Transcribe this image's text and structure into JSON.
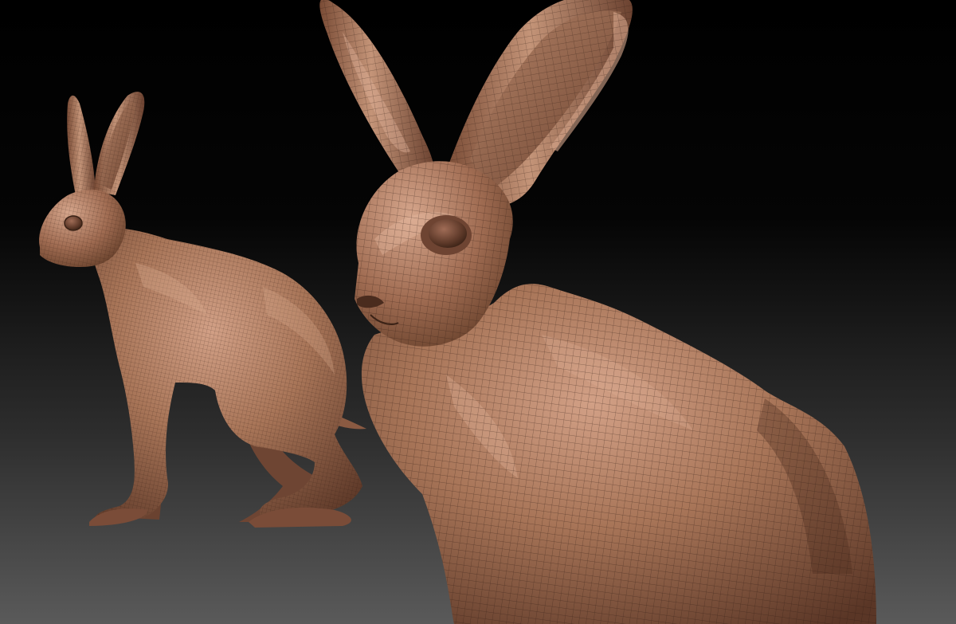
{
  "scene": {
    "description_colors": {
      "background_top": "#000000",
      "background_bottom": "#5a5a5a",
      "clay_light": "#c08c70",
      "clay_mid": "#9a6a52",
      "clay_dark": "#5e3a2a",
      "wire": "#2a1a12"
    },
    "models": [
      {
        "id": "hare-full-body",
        "view": "side"
      },
      {
        "id": "hare-closeup",
        "view": "three-quarter"
      }
    ]
  }
}
